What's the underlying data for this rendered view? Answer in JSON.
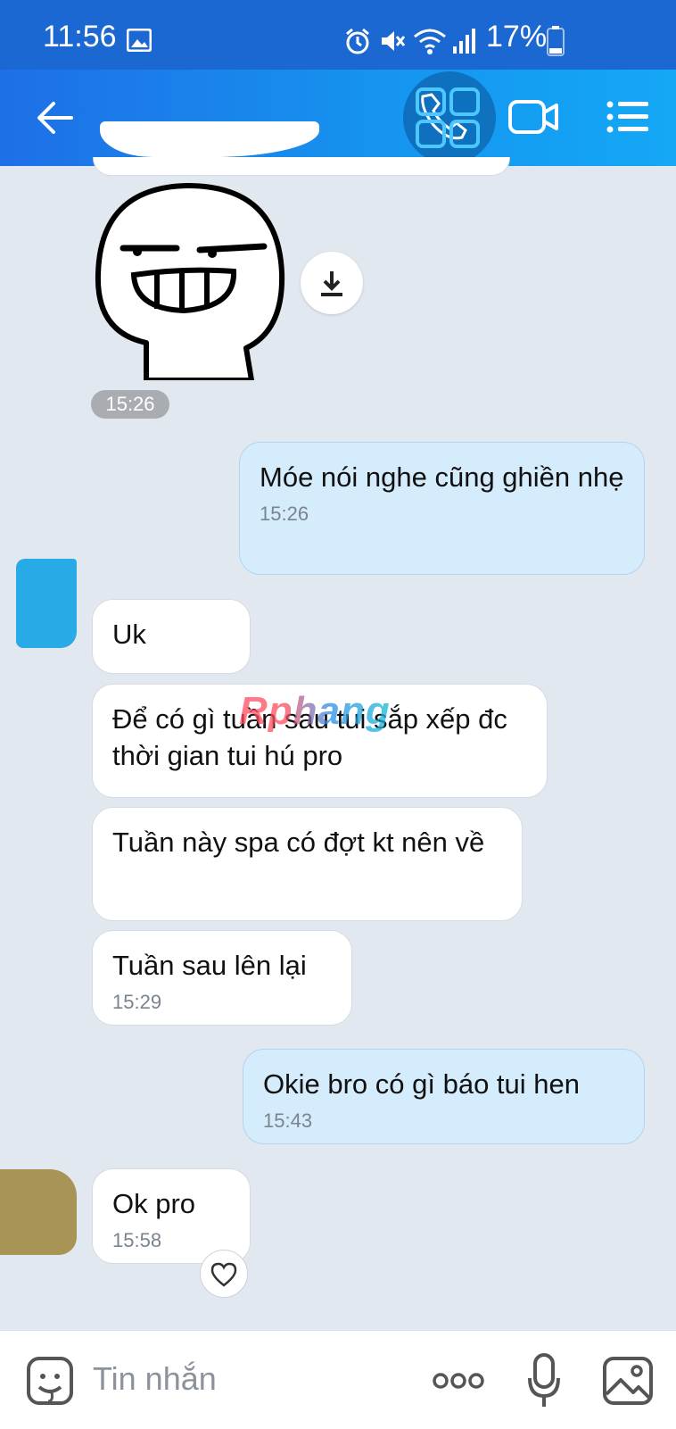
{
  "status_bar": {
    "time": "11:56",
    "battery_percent": "17%"
  },
  "header": {
    "back_icon": "arrow-left-icon",
    "contact_name_obscured": true,
    "actions": [
      "phone-icon",
      "video-camera-icon",
      "list-menu-icon"
    ]
  },
  "messages": {
    "sticker_time": "15:26",
    "m1": {
      "text": "Móe nói nghe cũng ghiền nhẹ",
      "time": "15:26"
    },
    "m2": {
      "text": "Uk"
    },
    "m3": {
      "text": "Để có gì tuần sau tui sắp xếp đc thời gian tui hú pro"
    },
    "m4": {
      "text": "Tuần này spa có đợt kt nên về"
    },
    "m5": {
      "text": "Tuần sau lên lại",
      "time": "15:29"
    },
    "m6": {
      "text": "Okie bro có gì báo tui hen",
      "time": "15:43"
    },
    "m7": {
      "text": "Ok pro",
      "time": "15:58"
    }
  },
  "watermark": "Rphang",
  "composer": {
    "placeholder": "Tin nhắn"
  },
  "colors": {
    "header_start": "#1e6fe6",
    "header_end": "#14a8f5",
    "chat_bg": "#e2e8f0",
    "outgoing_bubble": "#d5ecfd",
    "incoming_bubble": "#ffffff"
  }
}
